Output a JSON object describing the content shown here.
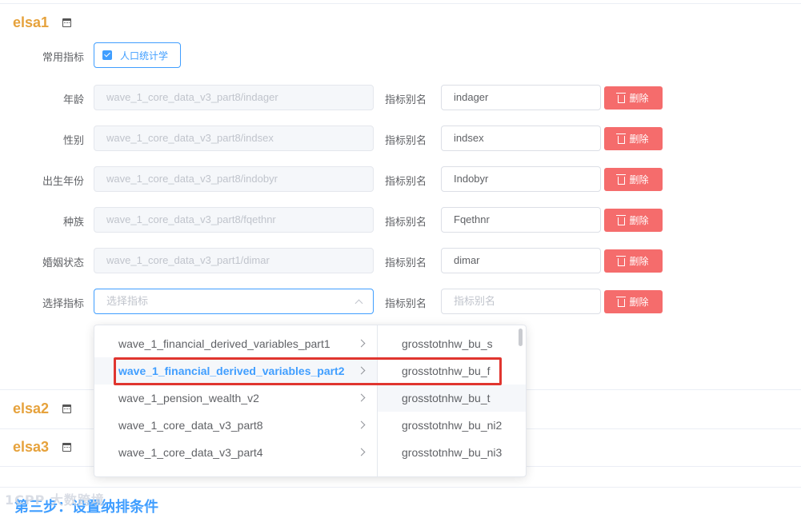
{
  "sections": {
    "elsa1": "elsa1",
    "elsa2": "elsa2",
    "elsa3": "elsa3"
  },
  "common": {
    "label": "常用指标",
    "checkbox_label": "人口统计学",
    "checked": true
  },
  "rows": [
    {
      "label": "年龄",
      "value": "wave_1_core_data_v3_part8/indager",
      "alias_label": "指标别名",
      "alias": "indager",
      "delete": "删除"
    },
    {
      "label": "性别",
      "value": "wave_1_core_data_v3_part8/indsex",
      "alias_label": "指标别名",
      "alias": "indsex",
      "delete": "删除"
    },
    {
      "label": "出生年份",
      "value": "wave_1_core_data_v3_part8/indobyr",
      "alias_label": "指标别名",
      "alias": "Indobyr",
      "delete": "删除"
    },
    {
      "label": "种族",
      "value": "wave_1_core_data_v3_part8/fqethnr",
      "alias_label": "指标别名",
      "alias": "Fqethnr",
      "delete": "删除"
    },
    {
      "label": "婚姻状态",
      "value": "wave_1_core_data_v3_part1/dimar",
      "alias_label": "指标别名",
      "alias": "dimar",
      "delete": "删除"
    }
  ],
  "select_row": {
    "label": "选择指标",
    "placeholder": "选择指标",
    "alias_label": "指标别名",
    "alias_placeholder": "指标别名",
    "delete": "删除"
  },
  "dropdown": {
    "level1": [
      {
        "label": "wave_1_financial_derived_variables_part1",
        "active": false
      },
      {
        "label": "wave_1_financial_derived_variables_part2",
        "active": true
      },
      {
        "label": "wave_1_pension_wealth_v2",
        "active": false
      },
      {
        "label": "wave_1_core_data_v3_part8",
        "active": false
      },
      {
        "label": "wave_1_core_data_v3_part4",
        "active": false
      }
    ],
    "level2": [
      {
        "label": "grosstotnhw_bu_s",
        "hover": false
      },
      {
        "label": "grosstotnhw_bu_f",
        "hover": false
      },
      {
        "label": "grosstotnhw_bu_t",
        "hover": true
      },
      {
        "label": "grosstotnhw_bu_ni2",
        "hover": false
      },
      {
        "label": "grosstotnhw_bu_ni3",
        "hover": false
      }
    ]
  },
  "step3": "第三步：设置纳排条件",
  "watermark": "1CPP 大数跨境",
  "colors": {
    "section_title": "#e6a23c",
    "primary": "#409eff",
    "danger": "#f56c6c",
    "highlight_box": "#e0352f"
  },
  "icons": {
    "section": "calendar-icon",
    "delete": "trash-icon",
    "select_arrow": "chevron-up-icon",
    "submenu": "chevron-right-icon"
  }
}
